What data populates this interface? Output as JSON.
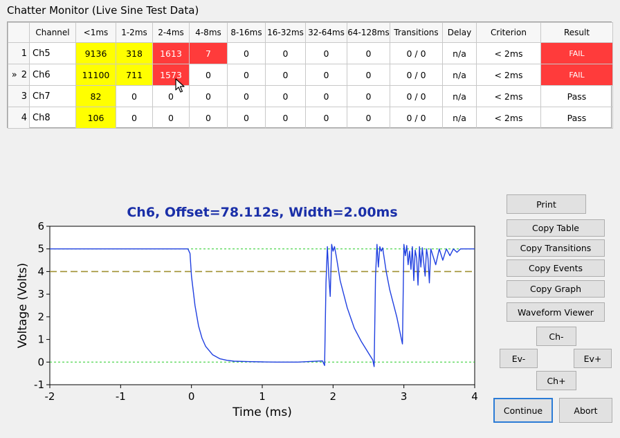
{
  "window": {
    "title": "Chatter Monitor (Live Sine Test Data)"
  },
  "table": {
    "columns": [
      "",
      "Channel",
      "<1ms",
      "1-2ms",
      "2-4ms",
      "4-8ms",
      "8-16ms",
      "16-32ms",
      "32-64ms",
      "64-128ms",
      "Transitions",
      "Delay",
      "Criterion",
      "Result"
    ],
    "rows": [
      {
        "marker": "",
        "num": "1",
        "channel": "Ch5",
        "cells": [
          "9136",
          "318",
          "1613",
          "7",
          "0",
          "0",
          "0",
          "0"
        ],
        "transitions": "0 / 0",
        "delay": "n/a",
        "criterion": "< 2ms",
        "result": "FAIL"
      },
      {
        "marker": "»",
        "num": "2",
        "channel": "Ch6",
        "cells": [
          "11100",
          "711",
          "1573",
          "0",
          "0",
          "0",
          "0",
          "0"
        ],
        "transitions": "0 / 0",
        "delay": "n/a",
        "criterion": "< 2ms",
        "result": "FAIL"
      },
      {
        "marker": "",
        "num": "3",
        "channel": "Ch7",
        "cells": [
          "82",
          "0",
          "0",
          "0",
          "0",
          "0",
          "0",
          "0"
        ],
        "transitions": "0 / 0",
        "delay": "n/a",
        "criterion": "< 2ms",
        "result": "Pass"
      },
      {
        "marker": "",
        "num": "4",
        "channel": "Ch8",
        "cells": [
          "106",
          "0",
          "0",
          "0",
          "0",
          "0",
          "0",
          "0"
        ],
        "transitions": "0 / 0",
        "delay": "n/a",
        "criterion": "< 2ms",
        "result": "Pass"
      }
    ],
    "colors": {
      "warn": "#ffff00",
      "fail": "#ff3b3b"
    }
  },
  "buttons": {
    "print": "Print",
    "copy_table": "Copy Table",
    "copy_transitions": "Copy Transitions",
    "copy_events": "Copy Events",
    "copy_graph": "Copy Graph",
    "waveform_viewer": "Waveform Viewer",
    "ch_minus": "Ch-",
    "ev_minus": "Ev-",
    "ev_plus": "Ev+",
    "ch_plus": "Ch+",
    "continue": "Continue",
    "abort": "Abort"
  },
  "chart_data": {
    "type": "line",
    "title": "Ch6, Offset=78.112s, Width=2.00ms",
    "xlabel": "Time (ms)",
    "ylabel": "Voltage (Volts)",
    "xlim": [
      -2,
      4
    ],
    "ylim": [
      -1,
      6
    ],
    "xticks": [
      -2,
      -1,
      0,
      1,
      2,
      3,
      4
    ],
    "yticks": [
      -1,
      0,
      1,
      2,
      3,
      4,
      5,
      6
    ],
    "grid": false,
    "reference_lines": [
      {
        "y": 5,
        "style": "dotted",
        "color": "#22cc22"
      },
      {
        "y": 0,
        "style": "dotted",
        "color": "#22cc22"
      },
      {
        "y": 4,
        "style": "dashed",
        "color": "#a09030"
      }
    ],
    "series": [
      {
        "color": "#1f3fe0",
        "x": [
          -2,
          -0.05,
          -0.02,
          0.0,
          0.05,
          0.1,
          0.15,
          0.2,
          0.3,
          0.4,
          0.5,
          0.6,
          0.8,
          1.0,
          1.2,
          1.5,
          1.85,
          1.88,
          1.9,
          1.92,
          1.94,
          1.96,
          1.98,
          2.0,
          2.02,
          2.05,
          2.1,
          2.2,
          2.3,
          2.4,
          2.5,
          2.56,
          2.58,
          2.6,
          2.62,
          2.64,
          2.66,
          2.68,
          2.7,
          2.75,
          2.8,
          2.9,
          2.98,
          3.0,
          3.02,
          3.04,
          3.06,
          3.08,
          3.1,
          3.12,
          3.14,
          3.16,
          3.18,
          3.2,
          3.22,
          3.24,
          3.26,
          3.28,
          3.3,
          3.32,
          3.34,
          3.36,
          3.38,
          3.4,
          3.45,
          3.5,
          3.55,
          3.6,
          3.65,
          3.7,
          3.75,
          3.8,
          4.0
        ],
        "y": [
          5,
          5,
          4.8,
          3.8,
          2.5,
          1.6,
          1.05,
          0.7,
          0.32,
          0.15,
          0.08,
          0.04,
          0.02,
          0.01,
          0.0,
          0.0,
          0.05,
          -0.15,
          3.5,
          5.1,
          3.8,
          2.9,
          5.2,
          4.9,
          5.1,
          4.6,
          3.6,
          2.4,
          1.5,
          0.9,
          0.4,
          0.1,
          -0.2,
          3.8,
          5.2,
          4.2,
          5.1,
          4.9,
          5.05,
          4.0,
          3.2,
          2.0,
          0.8,
          5.2,
          4.7,
          5.15,
          4.3,
          4.9,
          4.1,
          5.1,
          3.6,
          4.95,
          4.6,
          3.4,
          5.1,
          4.2,
          5.05,
          4.4,
          3.8,
          5.0,
          4.6,
          3.5,
          5.0,
          4.8,
          4.3,
          5.0,
          4.5,
          5.0,
          4.7,
          5.0,
          4.85,
          5.0,
          5.0
        ]
      }
    ]
  }
}
